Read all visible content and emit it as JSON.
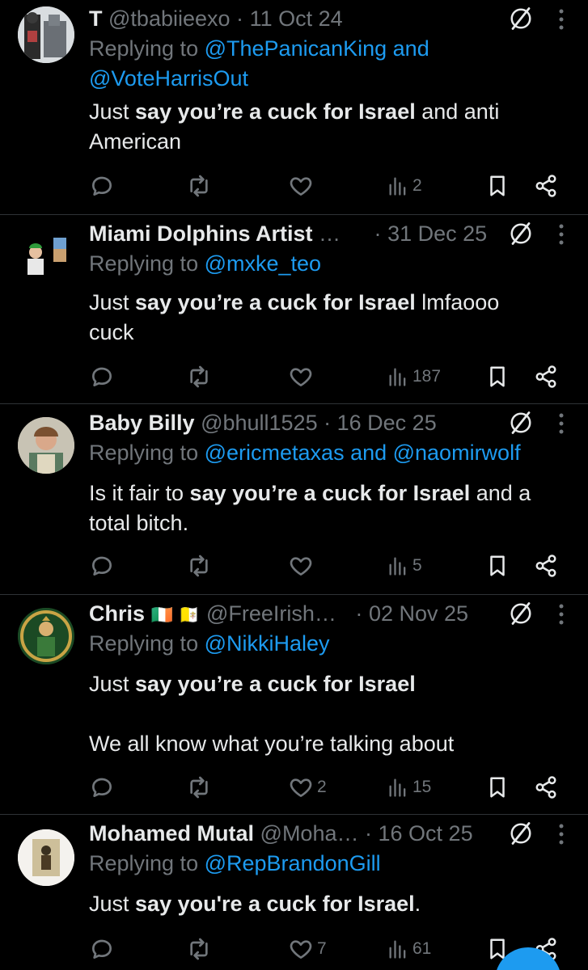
{
  "tweets": [
    {
      "name": "T",
      "handle": "@tbabiieexo",
      "date": "11 Oct 24",
      "replying_prefix": "Replying to",
      "replying_line1": "@ThePanicanKing and",
      "replying_line2": "@VoteHarrisOut",
      "body_line1_a": "Just ",
      "body_line1_b": "say you’re a cuck for Israel",
      "body_line1_c": " and anti",
      "body_line2": "American",
      "views": "2",
      "likes": ""
    },
    {
      "name": "Miami Dolphins Artist",
      "handle": "…",
      "date": "31 Dec 25",
      "replying_prefix": "Replying to",
      "replying_line1": "@mxke_teo",
      "body_line1_a": "Just ",
      "body_line1_b": "say you’re a cuck for Israel",
      "body_line1_c": " lmfaooo",
      "body_line2": "cuck",
      "views": "187",
      "likes": ""
    },
    {
      "name": "Baby Billy",
      "handle": "@bhull1525",
      "date": "16 Dec 25",
      "replying_prefix": "Replying to",
      "replying_line1": "@ericmetaxas and @naomirwolf",
      "body_line1_a": "Is it fair to ",
      "body_line1_b": "say you’re a cuck for Israel",
      "body_line1_c": " and a",
      "body_line2": "total bitch.",
      "views": "5",
      "likes": ""
    },
    {
      "name": "Chris",
      "flags": "🇮🇪 🇻🇦",
      "handle": "@FreeIrish…",
      "date": "02 Nov 25",
      "replying_prefix": "Replying to",
      "replying_line1": "@NikkiHaley",
      "body_line1_a": "Just ",
      "body_line1_b": "say you’re a cuck for Israel",
      "body_line1_c": "",
      "body_line2": "We all know what you’re talking about",
      "views": "15",
      "likes": "2"
    },
    {
      "name": "Mohamed Mutal",
      "handle": "@Moha…",
      "date": "16 Oct 25",
      "replying_prefix": "Replying to",
      "replying_line1": "@RepBrandonGill",
      "body_line1_a": "Just ",
      "body_line1_b": "say you're a cuck for Israel",
      "body_line1_c": ".",
      "views": "61",
      "likes": "7"
    }
  ],
  "colors": {
    "background": "#000000",
    "text": "#e7e9ea",
    "muted": "#71767b",
    "link": "#1d9bf0",
    "divider": "#2f3336"
  },
  "icons": [
    "reply-icon",
    "retweet-icon",
    "like-icon",
    "views-icon",
    "bookmark-icon",
    "share-icon",
    "grok-icon",
    "more-icon"
  ]
}
